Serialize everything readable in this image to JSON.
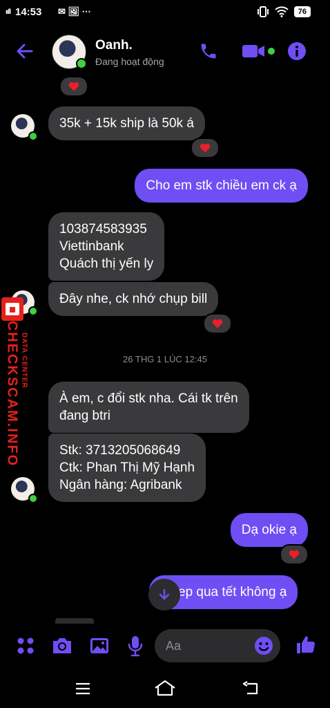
{
  "status_bar": {
    "signal": "ııll",
    "time": "14:53",
    "notif_icons": "✉ 🖼 ⋯",
    "battery": "76"
  },
  "header": {
    "contact_name": "Oanh.",
    "presence": "Đang hoạt động",
    "accent_color": "#6f4ef4",
    "icons": [
      "back-arrow-icon",
      "phone-icon",
      "video-icon",
      "info-icon"
    ]
  },
  "messages": [
    {
      "id": "m1",
      "from": "contact",
      "text": "35k + 15k ship là 50k á",
      "reaction": "heart"
    },
    {
      "id": "m2",
      "from": "me",
      "text": "Cho em stk chiều em ck ạ"
    },
    {
      "id": "m3",
      "from": "contact",
      "lines": [
        "103874583935",
        "Viettinbank",
        "Quách thị yến ly"
      ]
    },
    {
      "id": "m4",
      "from": "contact",
      "text": "Đây nhe, ck nhớ chụp bill",
      "reaction": "heart"
    },
    {
      "id": "m5",
      "from": "contact",
      "lines": [
        "À em, c đổi stk nha. Cái tk trên",
        "đang btri"
      ]
    },
    {
      "id": "m6",
      "from": "contact",
      "lines": [
        "Stk: 3713205068649",
        "Ctk: Phan Thị Mỹ Hạnh",
        "Ngân hàng: Agribank"
      ]
    },
    {
      "id": "m7",
      "from": "me",
      "text": "Dạ okie ạ",
      "reaction": "heart"
    },
    {
      "id": "m8",
      "from": "me",
      "text": "ep qua tết không ạ"
    }
  ],
  "timestamp": "26 THG 1 LÚC 12:45",
  "watermark": {
    "main": "CHECKSCAM.INFO",
    "sub": "DATA CENTER"
  },
  "composer": {
    "placeholder": "Aa",
    "icons": [
      "apps-icon",
      "camera-icon",
      "gallery-icon",
      "mic-icon",
      "emoji-icon",
      "like-icon"
    ]
  }
}
